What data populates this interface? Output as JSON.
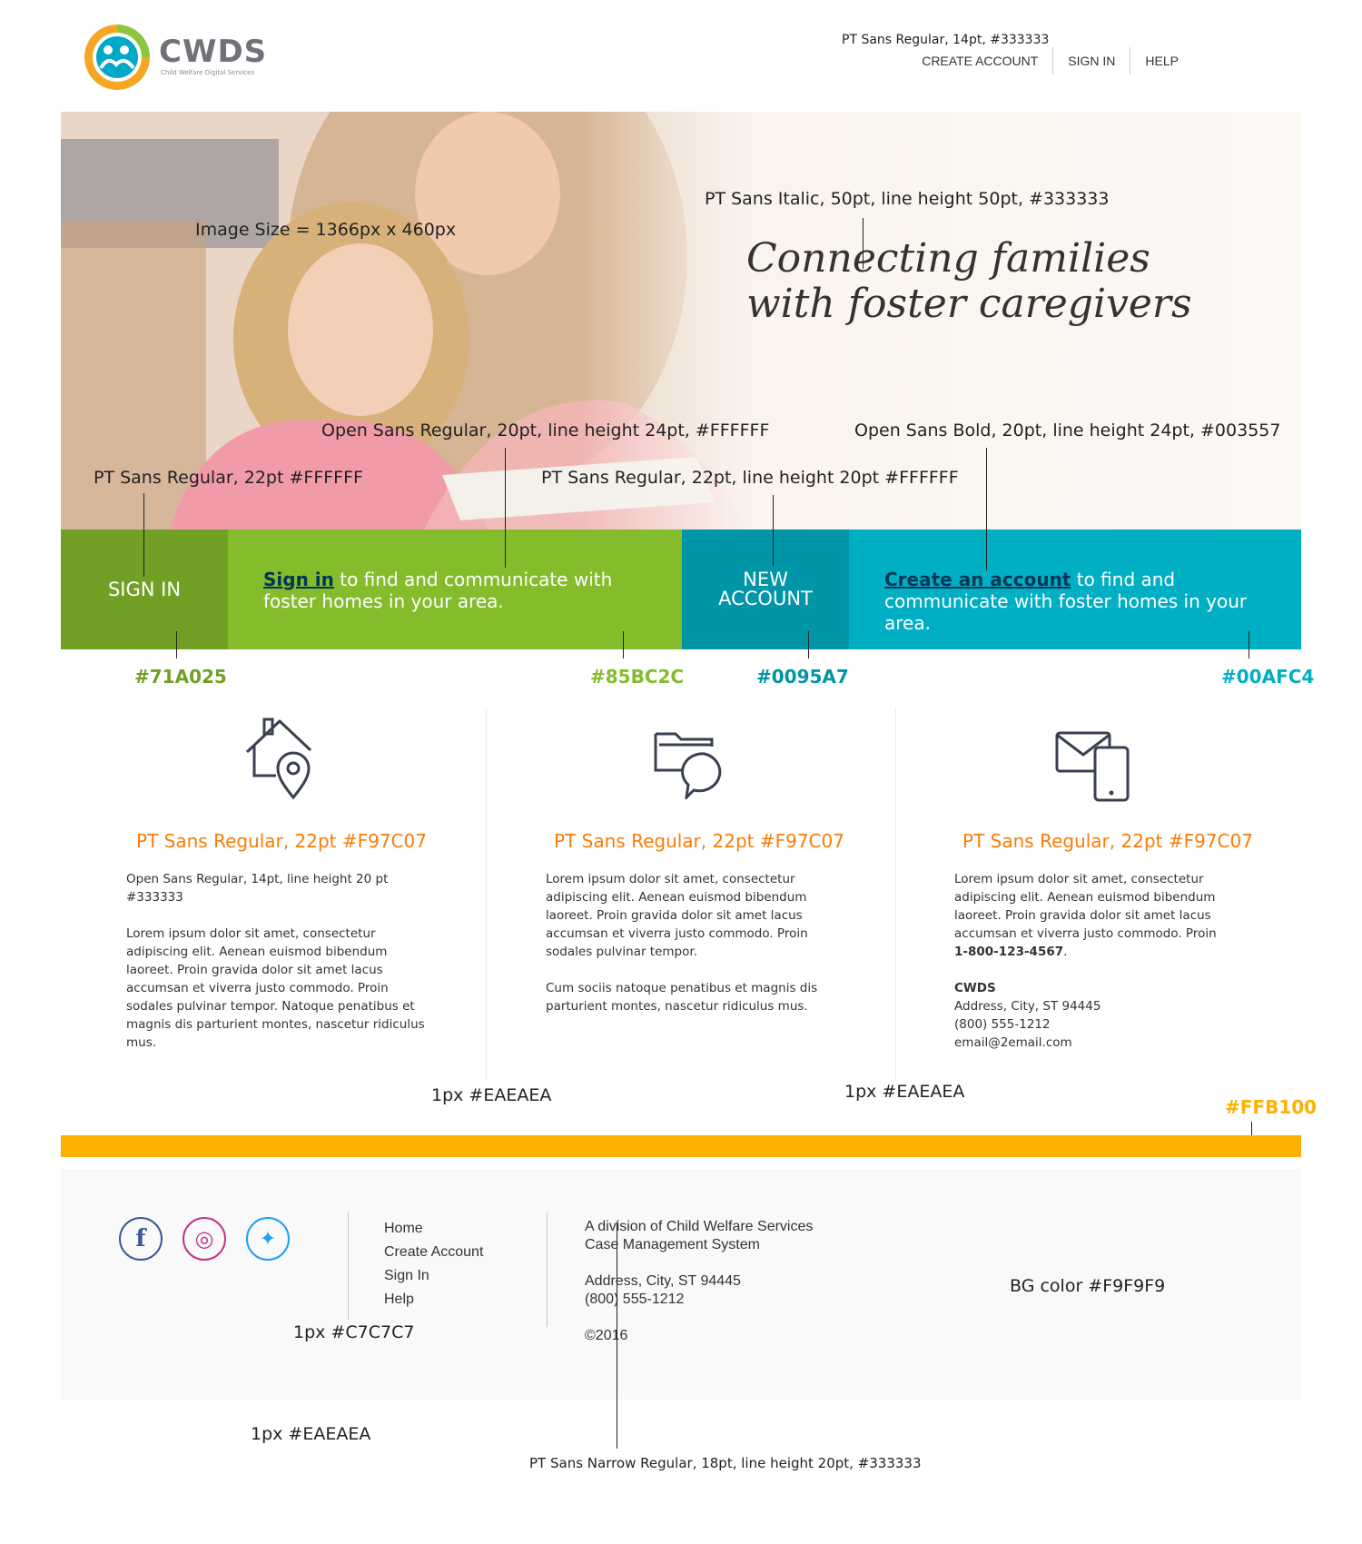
{
  "header": {
    "logo_word": "CWDS",
    "logo_sub": "Child Welfare Digital Services",
    "nav": [
      {
        "label": "CREATE ACCOUNT"
      },
      {
        "label": "SIGN IN"
      },
      {
        "label": "HELP"
      }
    ]
  },
  "hero": {
    "headline_line1": "Connecting families",
    "headline_line2": "with foster caregivers"
  },
  "band": {
    "signin_label": "SIGN IN",
    "signin_link": "Sign in",
    "signin_text": " to find and communicate with foster homes in your area.",
    "new_account_line1": "NEW",
    "new_account_line2": "ACCOUNT",
    "create_link": "Create an account",
    "create_text": " to find and communicate with foster homes in your area."
  },
  "columns": [
    {
      "icon": "house-location-icon",
      "title": "PT Sans Regular, 22pt #F97C07",
      "paragraphs": [
        "Open Sans Regular, 14pt, line height 20 pt #333333",
        "Lorem ipsum dolor sit amet, consectetur adipiscing elit. Aenean euismod bibendum laoreet. Proin gravida dolor sit amet lacus accumsan et viverra justo commodo. Proin sodales pulvinar tempor. Natoque penatibus et magnis dis parturient montes, nascetur ridiculus mus."
      ]
    },
    {
      "icon": "folder-chat-icon",
      "title": "PT Sans Regular, 22pt #F97C07",
      "paragraphs": [
        "Lorem ipsum dolor sit amet, consectetur adipiscing elit. Aenean euismod bibendum laoreet. Proin gravida dolor sit amet lacus accumsan et viverra justo commodo. Proin sodales pulvinar tempor.",
        "Cum sociis natoque penatibus et magnis dis parturient montes, nascetur ridiculus mus."
      ]
    },
    {
      "icon": "mail-phone-icon",
      "title": "PT Sans Regular, 22pt #F97C07",
      "paragraph": "Lorem ipsum dolor sit amet, consectetur adipiscing elit. Aenean euismod bibendum laoreet. Proin gravida dolor sit amet lacus accumsan et viverra justo commodo. Proin",
      "phone": "1-800-123-4567",
      "contact_name": "CWDS",
      "contact_address": "Address, City, ST 94445",
      "contact_phone": "(800) 555-1212",
      "contact_email": "email@2email.com"
    }
  ],
  "footer": {
    "social": [
      {
        "icon": "facebook-icon",
        "glyph": "f",
        "color": "#3b5998"
      },
      {
        "icon": "instagram-icon",
        "glyph": "◎",
        "color": "#c13584"
      },
      {
        "icon": "twitter-icon",
        "glyph": "✦",
        "color": "#1da1f2"
      }
    ],
    "nav": [
      {
        "label": "Home"
      },
      {
        "label": "Create Account"
      },
      {
        "label": "Sign In"
      },
      {
        "label": "Help"
      }
    ],
    "division_line1": "A division of Child Welfare Services",
    "division_line2": "Case Management System",
    "address": "Address, City, ST 94445",
    "phone": "(800) 555-1212",
    "copyright": "©2016"
  },
  "annotations": {
    "nav_font": "PT Sans Regular, 14pt, #333333",
    "headline_font": "PT Sans Italic, 50pt, line height 50pt,  #333333",
    "image_size": "Image Size = 1366px x 460px",
    "band_body_font": "Open Sans Regular, 20pt, line height 24pt,  #FFFFFF",
    "band_link_font": "Open Sans Bold, 20pt, line height 24pt,  #003557",
    "signin_font": "PT Sans Regular, 22pt #FFFFFF",
    "new_account_font": "PT Sans Regular, 22pt, line height 20pt #FFFFFF",
    "swatch_1": "#71A025",
    "swatch_2": "#85BC2C",
    "swatch_3": "#0095A7",
    "swatch_4": "#00AFC4",
    "divider_1": "1px #EAEAEA",
    "divider_2": "1px #EAEAEA",
    "yellow_color": "#FFB100",
    "footer_divider": "1px #C7C7C7",
    "footer_bg": "BG color #F9F9F9",
    "footer_border": "1px #EAEAEA",
    "footer_font": "PT Sans Narrow Regular, 18pt, line height 20pt, #333333"
  },
  "colors": {
    "signin_block": "#71A025",
    "signin_band": "#85BC2C",
    "account_block": "#0095A7",
    "account_band": "#00AFC4",
    "accent_orange": "#F97C07",
    "link_navy": "#003557",
    "yellow": "#FFB100",
    "footer_bg": "#F9F9F9"
  }
}
